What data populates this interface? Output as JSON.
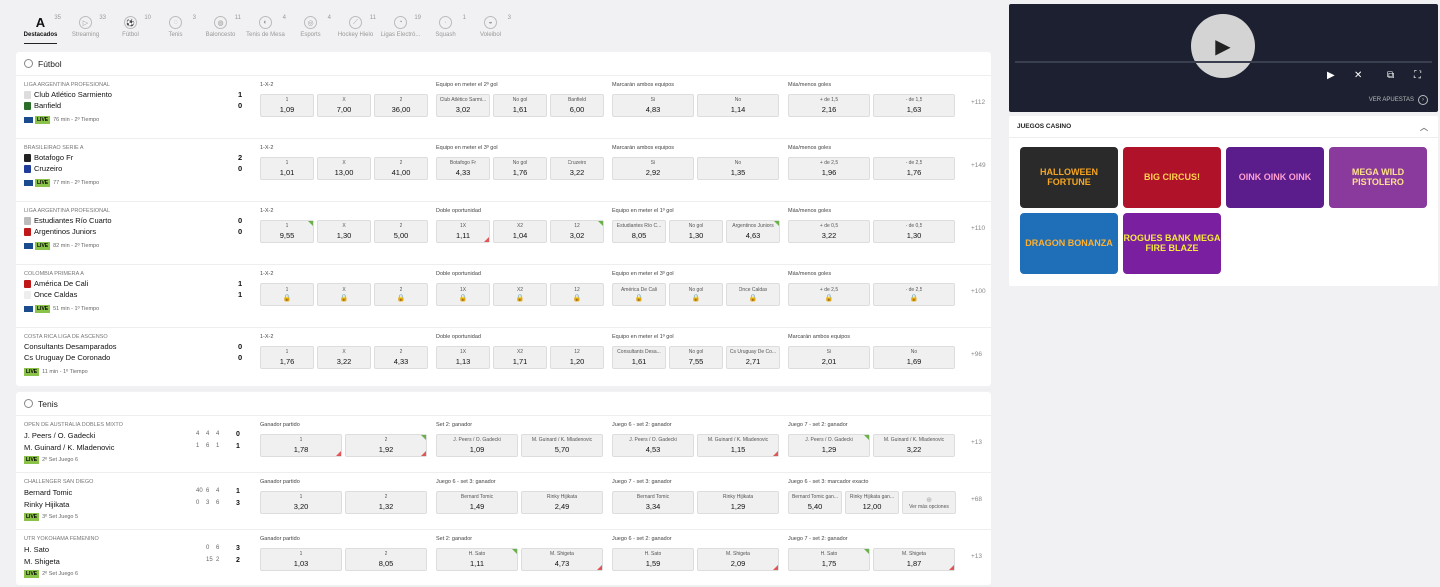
{
  "sports_nav": [
    {
      "name": "Destacados",
      "count": "35",
      "icon": "A"
    },
    {
      "name": "Streaming",
      "count": "33",
      "icon": "▷"
    },
    {
      "name": "Fútbol",
      "count": "10",
      "icon": "⚽"
    },
    {
      "name": "Tenis",
      "count": "3",
      "icon": "◌"
    },
    {
      "name": "Baloncesto",
      "count": "11",
      "icon": "◍"
    },
    {
      "name": "Tenis de Mesa",
      "count": "4",
      "icon": "◐"
    },
    {
      "name": "Esports",
      "count": "4",
      "icon": "◎"
    },
    {
      "name": "Hockey Hielo",
      "count": "11",
      "icon": "⟋"
    },
    {
      "name": "Ligas Electró...",
      "count": "19",
      "icon": "◔"
    },
    {
      "name": "Squash",
      "count": "1",
      "icon": "·"
    },
    {
      "name": "Voleibol",
      "count": "3",
      "icon": "◒"
    }
  ],
  "futbol": {
    "title": "Fútbol",
    "matches": [
      {
        "league": "Liga Argentina Profesional",
        "home": "Club Atlético Sarmiento",
        "away": "Banfield",
        "sh": "1",
        "sa": "0",
        "status": "76 min - 2º Tiempo",
        "more": "+112",
        "markets": [
          {
            "title": "1-X-2",
            "odds": [
              {
                "l": "1",
                "v": "1,09"
              },
              {
                "l": "X",
                "v": "7,00"
              },
              {
                "l": "2",
                "v": "36,00"
              }
            ]
          },
          {
            "title": "Equipo en meter el 2º gol",
            "odds": [
              {
                "l": "Club Atlético Sarmi...",
                "v": "3,02"
              },
              {
                "l": "No gol",
                "v": "1,61"
              },
              {
                "l": "Banfield",
                "v": "6,00"
              }
            ]
          },
          {
            "title": "Marcarán ambos equipos",
            "odds": [
              {
                "l": "Sí",
                "v": "4,83"
              },
              {
                "l": "No",
                "v": "1,14"
              }
            ]
          },
          {
            "title": "Más/menos goles",
            "odds": [
              {
                "l": "+ de 1,5",
                "v": "2,16"
              },
              {
                "l": "- de 1,5",
                "v": "1,63"
              }
            ]
          }
        ]
      },
      {
        "league": "Brasileirao Serie A",
        "home": "Botafogo Fr",
        "away": "Cruzeiro",
        "sh": "2",
        "sa": "0",
        "status": "77 min - 2º Tiempo",
        "more": "+149",
        "markets": [
          {
            "title": "1-X-2",
            "odds": [
              {
                "l": "1",
                "v": "1,01"
              },
              {
                "l": "X",
                "v": "13,00"
              },
              {
                "l": "2",
                "v": "41,00"
              }
            ]
          },
          {
            "title": "Equipo en meter el 3º gol",
            "odds": [
              {
                "l": "Botafogo Fr",
                "v": "4,33"
              },
              {
                "l": "No gol",
                "v": "1,76"
              },
              {
                "l": "Cruzeiro",
                "v": "3,22"
              }
            ]
          },
          {
            "title": "Marcarán ambos equipos",
            "odds": [
              {
                "l": "Sí",
                "v": "2,92"
              },
              {
                "l": "No",
                "v": "1,35"
              }
            ]
          },
          {
            "title": "Más/menos goles",
            "odds": [
              {
                "l": "+ de 2,5",
                "v": "1,96"
              },
              {
                "l": "- de 2,5",
                "v": "1,76"
              }
            ]
          }
        ]
      },
      {
        "league": "Liga Argentina Profesional",
        "home": "Estudiantes Río Cuarto",
        "away": "Argentinos Juniors",
        "sh": "0",
        "sa": "0",
        "status": "82 min - 2º Tiempo",
        "more": "+110",
        "markets": [
          {
            "title": "1-X-2",
            "odds": [
              {
                "l": "1",
                "v": "9,55"
              },
              {
                "l": "X",
                "v": "1,30"
              },
              {
                "l": "2",
                "v": "5,00"
              }
            ]
          },
          {
            "title": "Doble oportunidad",
            "odds": [
              {
                "l": "1X",
                "v": "1,11"
              },
              {
                "l": "X2",
                "v": "1,04"
              },
              {
                "l": "12",
                "v": "3,02"
              }
            ]
          },
          {
            "title": "Equipo en meter el 1º gol",
            "odds": [
              {
                "l": "Estudiantes Río C...",
                "v": "8,05"
              },
              {
                "l": "No gol",
                "v": "1,30"
              },
              {
                "l": "Argentinos Juniors",
                "v": "4,63"
              }
            ]
          },
          {
            "title": "Más/menos goles",
            "odds": [
              {
                "l": "+ de 0,5",
                "v": "3,22"
              },
              {
                "l": "- de 0,5",
                "v": "1,30"
              }
            ]
          }
        ]
      },
      {
        "league": "Colombia Primera A",
        "home": "América De Cali",
        "away": "Once Caldas",
        "sh": "1",
        "sa": "1",
        "status": "51 min - 1º Tiempo",
        "more": "+100",
        "markets": [
          {
            "title": "1-X-2",
            "odds": [
              {
                "l": "1",
                "v": ""
              },
              {
                "l": "X",
                "v": ""
              },
              {
                "l": "2",
                "v": ""
              }
            ]
          },
          {
            "title": "Doble oportunidad",
            "odds": [
              {
                "l": "1X",
                "v": ""
              },
              {
                "l": "X2",
                "v": ""
              },
              {
                "l": "12",
                "v": ""
              }
            ]
          },
          {
            "title": "Equipo en meter el 3º gol",
            "odds": [
              {
                "l": "América De Cali",
                "v": ""
              },
              {
                "l": "No gol",
                "v": ""
              },
              {
                "l": "Once Caldas",
                "v": ""
              }
            ]
          },
          {
            "title": "Más/menos goles",
            "odds": [
              {
                "l": "+ de 2,5",
                "v": ""
              },
              {
                "l": "- de 2,5",
                "v": ""
              }
            ]
          }
        ]
      },
      {
        "league": "Costa Rica Liga De Ascenso",
        "home": "Consultants Desamparados",
        "away": "Cs Uruguay De Coronado",
        "sh": "0",
        "sa": "0",
        "status": "11 min - 1º Tiempo",
        "more": "+96",
        "markets": [
          {
            "title": "1-X-2",
            "odds": [
              {
                "l": "1",
                "v": "1,76"
              },
              {
                "l": "X",
                "v": "3,22"
              },
              {
                "l": "2",
                "v": "4,33"
              }
            ]
          },
          {
            "title": "Doble oportunidad",
            "odds": [
              {
                "l": "1X",
                "v": "1,13"
              },
              {
                "l": "X2",
                "v": "1,71"
              },
              {
                "l": "12",
                "v": "1,20"
              }
            ]
          },
          {
            "title": "Equipo en meter el 1º gol",
            "odds": [
              {
                "l": "Consultants Desa...",
                "v": "1,61"
              },
              {
                "l": "No gol",
                "v": "7,55"
              },
              {
                "l": "Cs Uruguay De Co...",
                "v": "2,71"
              }
            ]
          },
          {
            "title": "Marcarán ambos equipos",
            "odds": [
              {
                "l": "Sí",
                "v": "2,01"
              },
              {
                "l": "No",
                "v": "1,69"
              }
            ]
          }
        ]
      }
    ]
  },
  "tenis": {
    "title": "Tenis",
    "matches": [
      {
        "league": "Open de Australia Dobles Mixto",
        "p1": "J. Peers / O. Gadecki",
        "p2": "M. Guinard / K. Mladenovic",
        "s1": [
          "4",
          "4",
          "4",
          "0"
        ],
        "s2": [
          "1",
          "6",
          "1",
          "1"
        ],
        "status": "2º Set Juego 6",
        "more": "+13",
        "markets": [
          {
            "title": "Ganador partido",
            "odds": [
              {
                "l": "1",
                "v": "1,78"
              },
              {
                "l": "2",
                "v": "1,92"
              }
            ]
          },
          {
            "title": "Set 2: ganador",
            "odds": [
              {
                "l": "J. Peers / O. Gadecki",
                "v": "1,09"
              },
              {
                "l": "M. Guinard / K. Mladenovic",
                "v": "5,70"
              }
            ]
          },
          {
            "title": "Juego 6 - set 2: ganador",
            "odds": [
              {
                "l": "J. Peers / O. Gadecki",
                "v": "4,53"
              },
              {
                "l": "M. Guinard / K. Mladenovic",
                "v": "1,15"
              }
            ]
          },
          {
            "title": "Juego 7 - set 2: ganador",
            "odds": [
              {
                "l": "J. Peers / O. Gadecki",
                "v": "1,29"
              },
              {
                "l": "M. Guinard / K. Mladenovic",
                "v": "3,22"
              }
            ]
          }
        ]
      },
      {
        "league": "Challenger San Diego",
        "p1": "Bernard Tomic",
        "p2": "Rinky Hijikata",
        "s1": [
          "40",
          "6",
          "4",
          "1"
        ],
        "s2": [
          "0",
          "3",
          "6",
          "3"
        ],
        "status": "3º Set Juego 5",
        "more": "+68",
        "markets": [
          {
            "title": "Ganador partido",
            "odds": [
              {
                "l": "1",
                "v": "3,20"
              },
              {
                "l": "2",
                "v": "1,32"
              }
            ]
          },
          {
            "title": "Juego 6 - set 3: ganador",
            "odds": [
              {
                "l": "Bernard Tomic",
                "v": "1,49"
              },
              {
                "l": "Rinky Hijikata",
                "v": "2,49"
              }
            ]
          },
          {
            "title": "Juego 7 - set 3: ganador",
            "odds": [
              {
                "l": "Bernard Tomic",
                "v": "3,34"
              },
              {
                "l": "Rinky Hijikata",
                "v": "1,29"
              }
            ]
          },
          {
            "title": "Juego 6 - set 3: marcador exacto",
            "odds": [
              {
                "l": "Bernard Tomic gan...",
                "v": "5,40"
              },
              {
                "l": "Rinky Hijikata gan...",
                "v": "12,00"
              },
              {
                "l": "Ver más opciones",
                "v": ""
              }
            ]
          }
        ]
      },
      {
        "league": "UTR Yokohama Femenino",
        "p1": "H. Sato",
        "p2": "M. Shigeta",
        "s1": [
          "0",
          "6",
          "3"
        ],
        "s2": [
          "15",
          "2",
          "2"
        ],
        "status": "2º Set Juego 6",
        "more": "+13",
        "markets": [
          {
            "title": "Ganador partido",
            "odds": [
              {
                "l": "1",
                "v": "1,03"
              },
              {
                "l": "2",
                "v": "8,05"
              }
            ]
          },
          {
            "title": "Set 2: ganador",
            "odds": [
              {
                "l": "H. Sato",
                "v": "1,11"
              },
              {
                "l": "M. Shigeta",
                "v": "4,73"
              }
            ]
          },
          {
            "title": "Juego 6 - set 2: ganador",
            "odds": [
              {
                "l": "H. Sato",
                "v": "1,59"
              },
              {
                "l": "M. Shigeta",
                "v": "2,09"
              }
            ]
          },
          {
            "title": "Juego 7 - set 2: ganador",
            "odds": [
              {
                "l": "H. Sato",
                "v": "1,75"
              },
              {
                "l": "M. Shigeta",
                "v": "1,87"
              }
            ]
          }
        ]
      }
    ]
  },
  "live_label": "LIVE",
  "video": {
    "ver_apuestas": "VER APUESTAS"
  },
  "casino": {
    "title": "JUEGOS CASINO",
    "games": [
      {
        "name": "HALLOWEEN FORTUNE",
        "bg": "#2a2a2a",
        "fg": "#f5a623"
      },
      {
        "name": "BIG CIRCUS!",
        "bg": "#b0122a",
        "fg": "#ffd34d"
      },
      {
        "name": "OINK OINK OINK",
        "bg": "#5b1d8c",
        "fg": "#ff9fcf"
      },
      {
        "name": "MEGA WILD PISTOLERO",
        "bg": "#8a3a9c",
        "fg": "#ffe08a"
      },
      {
        "name": "DRAGON BONANZA",
        "bg": "#1f6fb8",
        "fg": "#ffb030"
      },
      {
        "name": "ROGUES BANK MEGA FIRE BLAZE",
        "bg": "#7a1fa0",
        "fg": "#f4ea3a"
      }
    ]
  }
}
